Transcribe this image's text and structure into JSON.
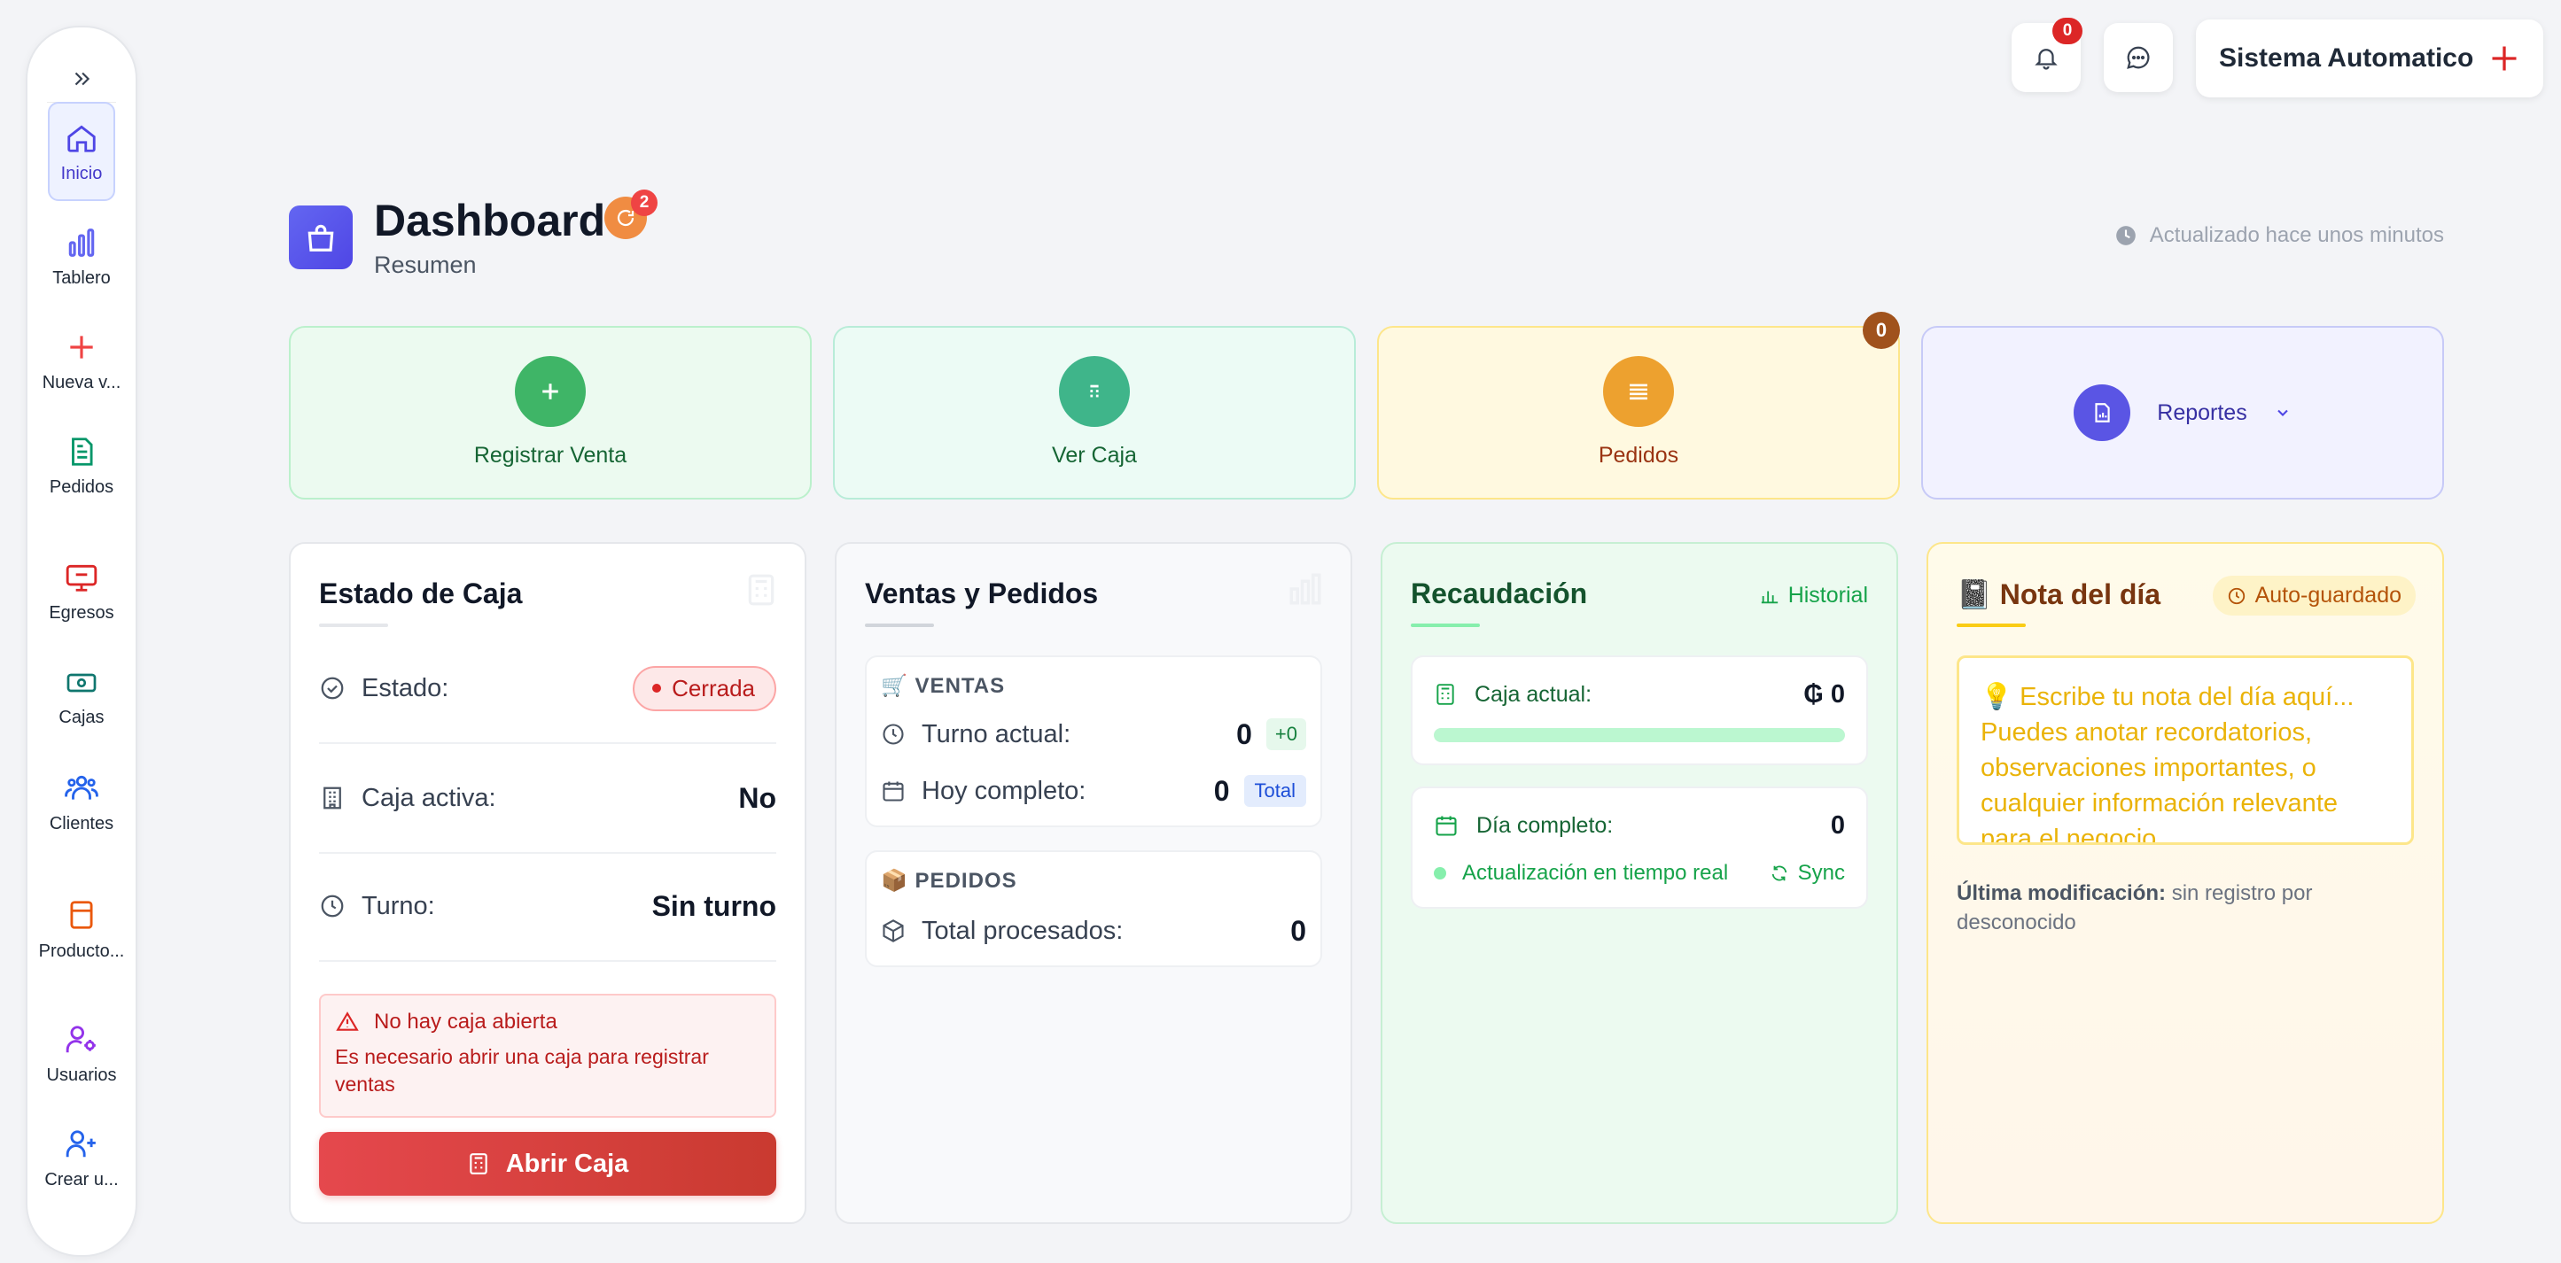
{
  "sidebar": {
    "toggle_icon": "chevrons-right-icon",
    "items": [
      {
        "label": "Inicio",
        "icon": "home-icon"
      },
      {
        "label": "Tablero",
        "icon": "bar-chart-icon"
      },
      {
        "label": "Nueva v...",
        "icon": "plus-icon"
      },
      {
        "label": "Pedidos",
        "icon": "document-icon"
      },
      {
        "label": "Egresos",
        "icon": "monitor-icon"
      },
      {
        "label": "Cajas",
        "icon": "cash-icon"
      },
      {
        "label": "Clientes",
        "icon": "users-icon"
      },
      {
        "label": "Producto...",
        "icon": "box-icon"
      },
      {
        "label": "Usuarios",
        "icon": "user-cog-icon"
      },
      {
        "label": "Crear u...",
        "icon": "user-plus-icon"
      }
    ]
  },
  "topbar": {
    "notifications_count": "0",
    "user_name": "Sistema Automatico"
  },
  "header": {
    "title": "Dashboard",
    "subtitle": "Resumen",
    "title_badge": "2",
    "updated_text": "Actualizado hace unos minutos"
  },
  "actions": {
    "register_sale": "Registrar Venta",
    "view_cash": "Ver Caja",
    "orders": "Pedidos",
    "orders_badge": "0",
    "reports": "Reportes"
  },
  "estado_caja": {
    "title": "Estado de Caja",
    "estado_label": "Estado:",
    "estado_value": "Cerrada",
    "caja_activa_label": "Caja activa:",
    "caja_activa_value": "No",
    "turno_label": "Turno:",
    "turno_value": "Sin turno",
    "alert_title": "No hay caja abierta",
    "alert_text": "Es necesario abrir una caja para registrar ventas",
    "open_button": "Abrir Caja"
  },
  "ventas_pedidos": {
    "title": "Ventas y Pedidos",
    "ventas_header": "🛒 VENTAS",
    "turno_actual_label": "Turno actual:",
    "turno_actual_value": "0",
    "turno_actual_delta": "+0",
    "hoy_label": "Hoy completo:",
    "hoy_value": "0",
    "hoy_tag": "Total",
    "pedidos_header": "📦 PEDIDOS",
    "total_label": "Total procesados:",
    "total_value": "0"
  },
  "recaudacion": {
    "title": "Recaudación",
    "historial": "Historial",
    "caja_actual_label": "Caja actual:",
    "caja_actual_value": "₲ 0",
    "caja_progress": 1,
    "dia_label": "Día completo:",
    "dia_value": "0",
    "realtime": "Actualización en tiempo real",
    "sync": "Sync"
  },
  "nota": {
    "title": "📓 Nota del día",
    "autosave": "Auto-guardado",
    "placeholder": "💡 Escribe tu nota del día aquí... Puedes anotar recordatorios, observaciones importantes, o cualquier información relevante para el negocio.",
    "last_mod_label": "Última modificación:",
    "last_mod_value": " sin registro por desconocido"
  },
  "colors": {
    "accent": "#4f46e5",
    "green": "#16a34a",
    "red": "#dc2626",
    "orange": "#ea9a2d",
    "yellow_border": "#fde68a"
  }
}
